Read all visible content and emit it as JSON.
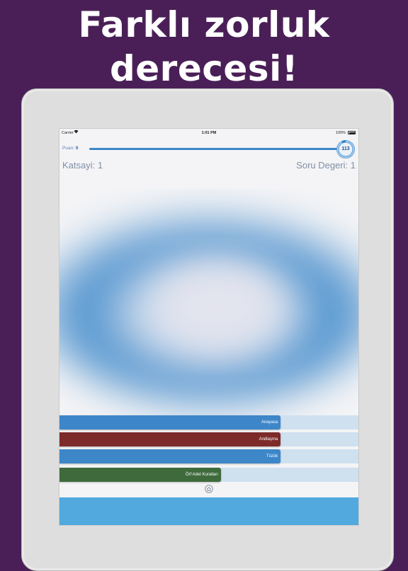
{
  "headline": {
    "line1": "Farklı zorluk",
    "line2": "derecesi!"
  },
  "colors": {
    "background": "#4a1f57",
    "accent_blue": "#3d86c8",
    "wrong_red": "#7d2a2a",
    "right_green": "#3f6b3c",
    "bottom_band": "#51a9de"
  },
  "status_bar": {
    "carrier": "Carrier",
    "wifi_icon": "wifi-icon",
    "time": "1:01 PM",
    "battery": "100%",
    "battery_level": 1.0
  },
  "game": {
    "score_label": "Puan:",
    "score_value": "0",
    "timer_value": "113",
    "timer_progress": 0.92,
    "progress_fraction": 1.0,
    "multiplier_text": "Katsayi: 1",
    "question_value_text": "Soru Degeri: 1"
  },
  "answers": [
    {
      "label": "Anayasa",
      "color": "#3d86c8",
      "fill": 0.74
    },
    {
      "label": "Andlaşma",
      "color": "#7d2a2a",
      "fill": 0.74
    },
    {
      "label": "Tüzük",
      "color": "#3d86c8",
      "fill": 0.74
    },
    {
      "label": "Örf Adet Kuralları",
      "color": "#3f6b3c",
      "fill": 0.54
    }
  ],
  "home_icon": "home-icon"
}
